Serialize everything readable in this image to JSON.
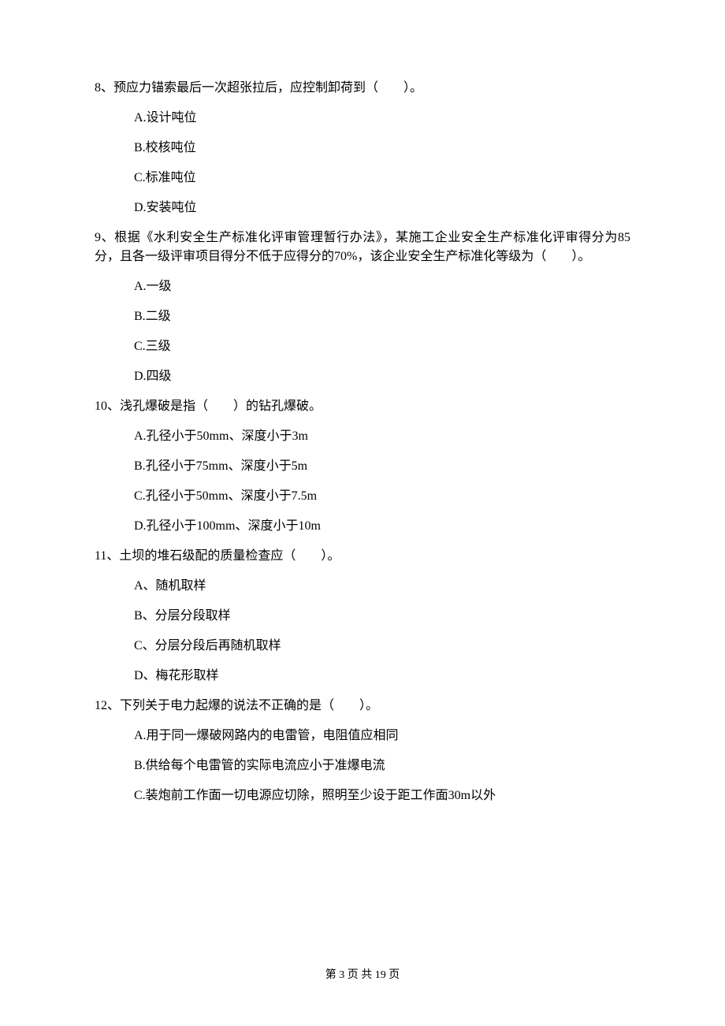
{
  "questions": [
    {
      "number": "8、",
      "text": "预应力锚索最后一次超张拉后，应控制卸荷到（　　）。",
      "options": [
        "A.设计吨位",
        "B.校核吨位",
        "C.标准吨位",
        "D.安装吨位"
      ]
    },
    {
      "number": "9、",
      "text": "根据《水利安全生产标准化评审管理暂行办法》，某施工企业安全生产标准化评审得分为85分，且各一级评审项目得分不低于应得分的70%，该企业安全生产标准化等级为（　　）。",
      "options": [
        "A.一级",
        "B.二级",
        "C.三级",
        "D.四级"
      ]
    },
    {
      "number": "10、",
      "text": "浅孔爆破是指（　　）的钻孔爆破。",
      "options": [
        "A.孔径小于50mm、深度小于3m",
        "B.孔径小于75mm、深度小于5m",
        "C.孔径小于50mm、深度小于7.5m",
        "D.孔径小于100mm、深度小于10m"
      ]
    },
    {
      "number": "11、",
      "text": "土坝的堆石级配的质量检查应（　　）。",
      "options": [
        "A、随机取样",
        "B、分层分段取样",
        "C、分层分段后再随机取样",
        "D、梅花形取样"
      ]
    },
    {
      "number": "12、",
      "text": "下列关于电力起爆的说法不正确的是（　　）。",
      "options": [
        "A.用于同一爆破网路内的电雷管，电阻值应相同",
        "B.供给每个电雷管的实际电流应小于准爆电流",
        "C.装炮前工作面一切电源应切除，照明至少设于距工作面30m以外"
      ]
    }
  ],
  "footer": "第 3 页 共 19 页"
}
